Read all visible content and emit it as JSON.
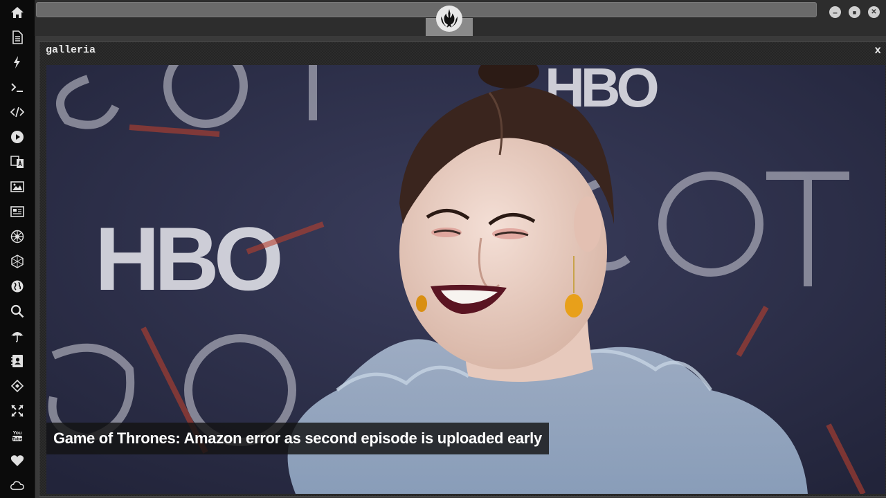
{
  "window": {
    "controls": {
      "minimize": "–",
      "maximize": "■",
      "close": "✕"
    },
    "logo_icon": "rebel-alliance-icon"
  },
  "sidebar": {
    "items": [
      {
        "icon": "home-icon"
      },
      {
        "icon": "document-icon"
      },
      {
        "icon": "lightning-icon"
      },
      {
        "icon": "terminal-icon"
      },
      {
        "icon": "code-icon"
      },
      {
        "icon": "play-icon"
      },
      {
        "icon": "translate-icon"
      },
      {
        "icon": "image-icon"
      },
      {
        "icon": "newspaper-icon"
      },
      {
        "icon": "empire-icon"
      },
      {
        "icon": "hexagon-network-icon"
      },
      {
        "icon": "globe-icon"
      },
      {
        "icon": "search-icon"
      },
      {
        "icon": "umbrella-icon"
      },
      {
        "icon": "contacts-icon"
      },
      {
        "icon": "code-diamond-icon"
      },
      {
        "icon": "expand-icon"
      },
      {
        "icon": "youtube-icon"
      },
      {
        "icon": "heart-icon"
      },
      {
        "icon": "cloud-icon"
      }
    ]
  },
  "panel": {
    "title": "galleria",
    "close_label": "x",
    "caption": "Game of Thrones: Amazon error as second episode is uploaded early"
  },
  "colors": {
    "sidebar_bg": "#0b0b0b",
    "icon_color": "#e0e0e0",
    "photo_bg": "#2b2d42",
    "caption_bg": "#141414"
  }
}
